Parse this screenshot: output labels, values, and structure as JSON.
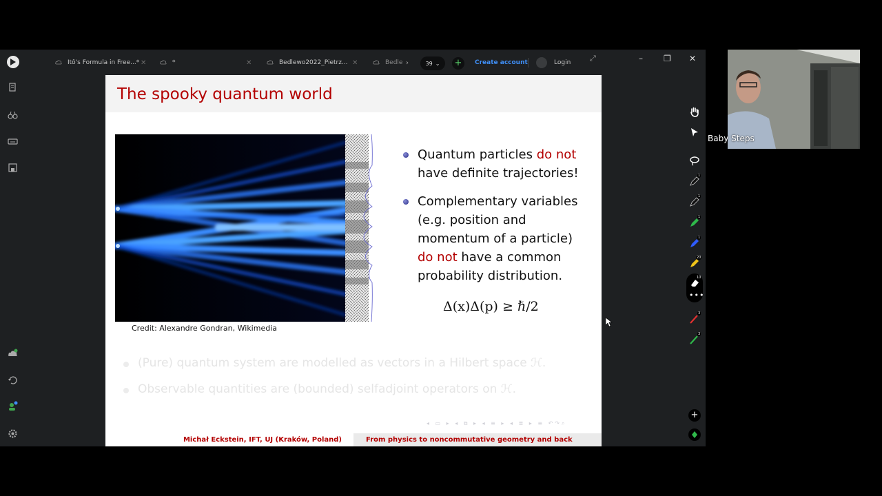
{
  "tabs": [
    {
      "label": "Itô's Formula in Free...*"
    },
    {
      "label": "*"
    },
    {
      "label": "Bedlewo2022_Pietrz..."
    },
    {
      "label": "Bedle"
    }
  ],
  "toolbar": {
    "page_count": "39",
    "create_account": "Create account",
    "login": "Login"
  },
  "slide": {
    "title": "The spooky quantum world",
    "credit": "Credit:  Alexandre Gondran, Wikimedia",
    "bullet1_a": "Quantum particles ",
    "bullet1_red": "do not",
    "bullet1_b": "have definite trajectories!",
    "bullet2_a": "Complementary variables (e.g.  position and momentum of a particle) ",
    "bullet2_red": "do not",
    "bullet2_b": " have a common probability distribution.",
    "formula": "Δ(x)Δ(p) ≥ ℏ/2",
    "faded1": "(Pure) quantum system are modelled as vectors in a Hilbert space ℋ.",
    "faded2": "Observable quantities are (bounded) selfadjoint operators on ℋ.",
    "footer_left": "Michał  Eckstein, IFT, UJ (Kraków, Poland)",
    "footer_right": "From physics to noncommutative geometry and back"
  },
  "right_toolbar_badges": {
    "b1": "1",
    "b2": "1",
    "b3": "1",
    "b4": "1",
    "b5": "20",
    "b6": "10",
    "b7": "3",
    "b8": "3"
  },
  "left_sidebar_badge": "1",
  "webcam": {
    "name": "Baby Steps"
  },
  "colors": {
    "accent_red": "#b30000",
    "link_blue": "#3f8ef5",
    "plus_green": "#5ad36b",
    "app_bg": "#1e2022"
  }
}
